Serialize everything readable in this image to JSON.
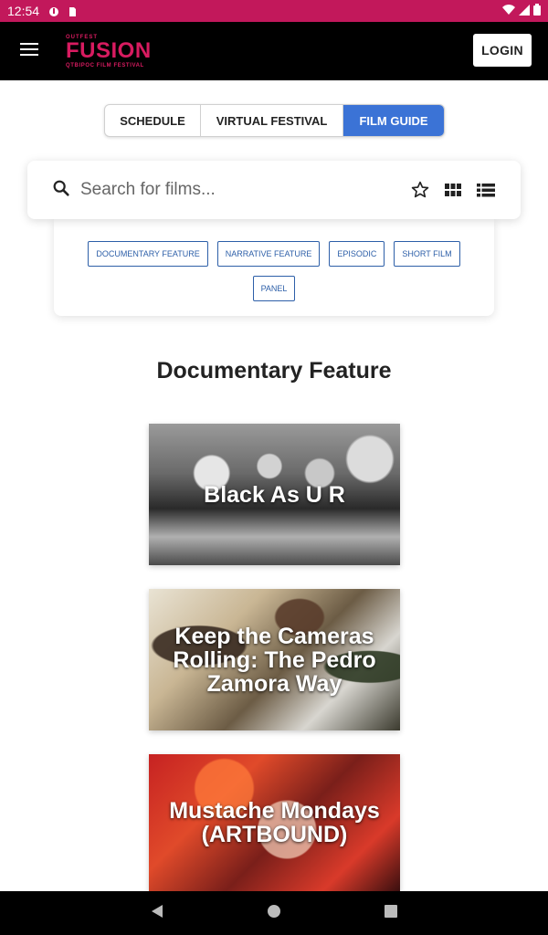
{
  "status_bar": {
    "time": "12:54"
  },
  "header": {
    "logo_small": "OUTFEST",
    "logo_main": "FUSION",
    "logo_sub": "QTBIPOC FILM FESTIVAL",
    "login_label": "LOGIN"
  },
  "tabs": [
    {
      "label": "SCHEDULE",
      "active": false
    },
    {
      "label": "VIRTUAL FESTIVAL",
      "active": false
    },
    {
      "label": "FILM GUIDE",
      "active": true
    }
  ],
  "search": {
    "placeholder": "Search for films...",
    "value": ""
  },
  "filters": [
    "DOCUMENTARY FEATURE",
    "NARRATIVE FEATURE",
    "EPISODIC",
    "SHORT FILM",
    "PANEL"
  ],
  "section": {
    "title": "Documentary Feature"
  },
  "films": [
    {
      "title": "Black As U R"
    },
    {
      "title": "Keep the Cameras Rolling: The Pedro Zamora Way"
    },
    {
      "title": "Mustache Mondays (ARTBOUND)"
    }
  ],
  "colors": {
    "status_bar": "#c2185b",
    "brand": "#d81b60",
    "accent": "#3b73d6",
    "chip": "#2d5fa8"
  }
}
